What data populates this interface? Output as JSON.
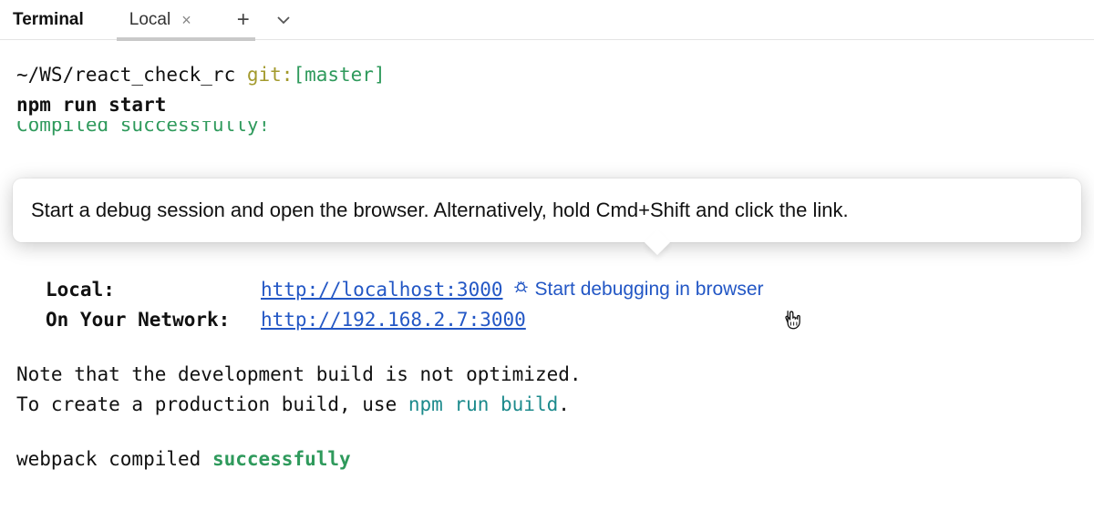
{
  "header": {
    "title": "Terminal",
    "tab": {
      "label": "Local"
    }
  },
  "tooltip": {
    "text": "Start a debug session and open the browser. Alternatively, hold Cmd+Shift and click the link."
  },
  "terminal": {
    "prompt": {
      "path": "~/WS/react_check_rc",
      "git_label": "git:",
      "branch": "[master]"
    },
    "command": "npm run start",
    "compiled_peek": "Compiled successfully!",
    "rows": [
      {
        "label": "Local:",
        "url": "http://localhost:3000",
        "has_debug": true,
        "debug_label": "Start debugging in browser"
      },
      {
        "label": "On Your Network:",
        "url": "http://192.168.2.7:3000",
        "has_debug": false
      }
    ],
    "note_line1": "Note that the development build is not optimized.",
    "note_line2_prefix": "To create a production build, use ",
    "note_line2_cmd": "npm run build",
    "note_line2_suffix": ".",
    "webpack_prefix": "webpack compiled ",
    "webpack_status": "successfully"
  }
}
